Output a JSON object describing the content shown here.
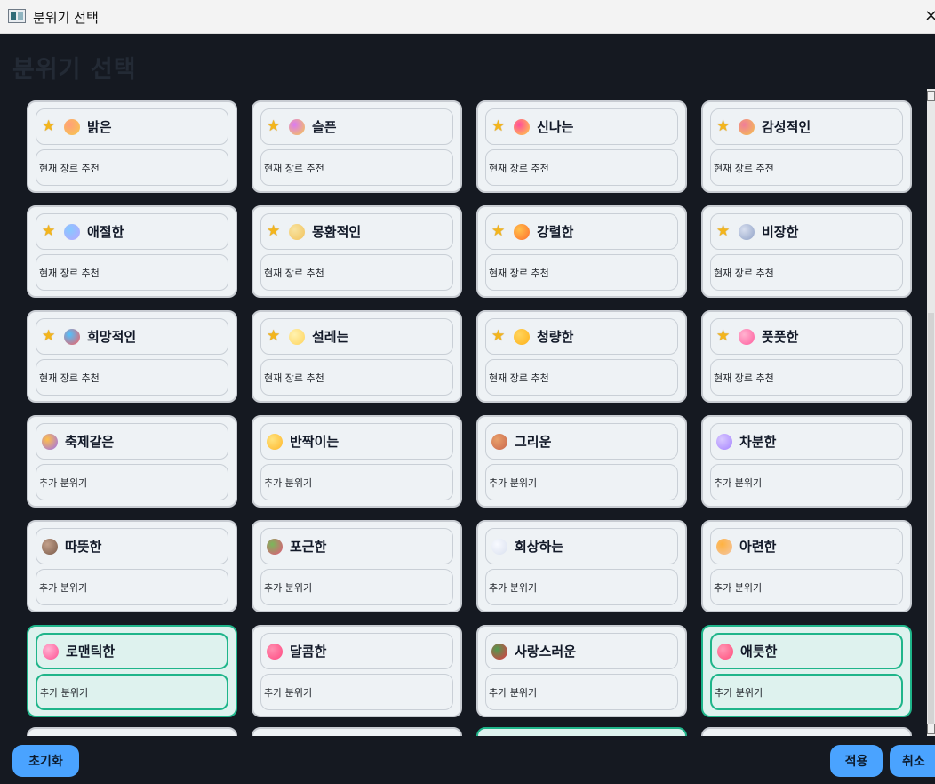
{
  "window": {
    "title": "분위기 선택"
  },
  "page": {
    "heading": "분위기 선택"
  },
  "moods": [
    {
      "name": "밝은",
      "subtitle": "현재 장르 추천",
      "recommended": true,
      "selected": false,
      "emoji_icon": "smiling-face",
      "emoji_colors": [
        "#f6c94c",
        "#ff9f7a"
      ]
    },
    {
      "name": "슬픈",
      "subtitle": "현재 장르 추천",
      "recommended": true,
      "selected": false,
      "emoji_icon": "sad-face",
      "emoji_colors": [
        "#f6c94c",
        "#db7bf2"
      ]
    },
    {
      "name": "신나는",
      "subtitle": "현재 장르 추천",
      "recommended": true,
      "selected": false,
      "emoji_icon": "grinning-face",
      "emoji_colors": [
        "#ffd044",
        "#ff4d9b"
      ]
    },
    {
      "name": "감성적인",
      "subtitle": "현재 장르 추천",
      "recommended": true,
      "selected": false,
      "emoji_icon": "crying-face",
      "emoji_colors": [
        "#f4c24c",
        "#f07d9a"
      ]
    },
    {
      "name": "애절한",
      "subtitle": "현재 장르 추천",
      "recommended": true,
      "selected": false,
      "emoji_icon": "crystal-heart",
      "emoji_colors": [
        "#b9a6ff",
        "#86c9ff"
      ]
    },
    {
      "name": "몽환적인",
      "subtitle": "현재 장르 추천",
      "recommended": true,
      "selected": false,
      "emoji_icon": "crescent-moon",
      "emoji_colors": [
        "#f1c25c",
        "#f8e3a0"
      ]
    },
    {
      "name": "강렬한",
      "subtitle": "현재 장르 추천",
      "recommended": true,
      "selected": false,
      "emoji_icon": "fire",
      "emoji_colors": [
        "#ff6d2d",
        "#ffc04b"
      ]
    },
    {
      "name": "비장한",
      "subtitle": "현재 장르 추천",
      "recommended": true,
      "selected": false,
      "emoji_icon": "crossed-swords",
      "emoji_colors": [
        "#8fa1c6",
        "#d8dfef"
      ]
    },
    {
      "name": "희망적인",
      "subtitle": "현재 장르 추천",
      "recommended": true,
      "selected": false,
      "emoji_icon": "rainbow",
      "emoji_colors": [
        "#ff5b5b",
        "#4ec3ff"
      ]
    },
    {
      "name": "설레는",
      "subtitle": "현재 장르 추천",
      "recommended": true,
      "selected": false,
      "emoji_icon": "sparkles",
      "emoji_colors": [
        "#ffd35a",
        "#fff2b0"
      ]
    },
    {
      "name": "청량한",
      "subtitle": "현재 장르 추천",
      "recommended": true,
      "selected": false,
      "emoji_icon": "sun",
      "emoji_colors": [
        "#ffb21a",
        "#ffd45c"
      ]
    },
    {
      "name": "풋풋한",
      "subtitle": "현재 장르 추천",
      "recommended": true,
      "selected": false,
      "emoji_icon": "cherry-blossom",
      "emoji_colors": [
        "#ff5c9d",
        "#ffb3d0"
      ]
    },
    {
      "name": "축제같은",
      "subtitle": "추가 분위기",
      "recommended": false,
      "selected": false,
      "emoji_icon": "party-popper",
      "emoji_colors": [
        "#9b6df2",
        "#ffc14a"
      ]
    },
    {
      "name": "반짝이는",
      "subtitle": "추가 분위기",
      "recommended": false,
      "selected": false,
      "emoji_icon": "dizzy-star",
      "emoji_colors": [
        "#ffb72c",
        "#ffe37e"
      ]
    },
    {
      "name": "그리운",
      "subtitle": "추가 분위기",
      "recommended": false,
      "selected": false,
      "emoji_icon": "fallen-leaf",
      "emoji_colors": [
        "#c9664d",
        "#e8a06a"
      ]
    },
    {
      "name": "차분한",
      "subtitle": "추가 분위기",
      "recommended": false,
      "selected": false,
      "emoji_icon": "purple-heart",
      "emoji_colors": [
        "#a684ff",
        "#d8c8ff"
      ]
    },
    {
      "name": "따뜻한",
      "subtitle": "추가 분위기",
      "recommended": false,
      "selected": false,
      "emoji_icon": "coffee-cup",
      "emoji_colors": [
        "#7a5a4a",
        "#c2a08a"
      ]
    },
    {
      "name": "포근한",
      "subtitle": "추가 분위기",
      "recommended": false,
      "selected": false,
      "emoji_icon": "tulip",
      "emoji_colors": [
        "#e9547c",
        "#79b85a"
      ]
    },
    {
      "name": "회상하는",
      "subtitle": "추가 분위기",
      "recommended": false,
      "selected": false,
      "emoji_icon": "cloud",
      "emoji_colors": [
        "#d9e0ef",
        "#f8faff"
      ]
    },
    {
      "name": "아련한",
      "subtitle": "추가 분위기",
      "recommended": false,
      "selected": false,
      "emoji_icon": "candle",
      "emoji_colors": [
        "#f2c6a7",
        "#ffb23f"
      ]
    },
    {
      "name": "로맨틱한",
      "subtitle": "추가 분위기",
      "recommended": false,
      "selected": true,
      "emoji_icon": "heart-sparkle",
      "emoji_colors": [
        "#ff4f93",
        "#ffb3d2"
      ]
    },
    {
      "name": "달콤한",
      "subtitle": "추가 분위기",
      "recommended": false,
      "selected": false,
      "emoji_icon": "two-hearts",
      "emoji_colors": [
        "#ff4a82",
        "#ff8fb0"
      ]
    },
    {
      "name": "사랑스러운",
      "subtitle": "추가 분위기",
      "recommended": false,
      "selected": false,
      "emoji_icon": "rose",
      "emoji_colors": [
        "#e63545",
        "#4f9c4f"
      ]
    },
    {
      "name": "애틋한",
      "subtitle": "추가 분위기",
      "recommended": false,
      "selected": true,
      "emoji_icon": "revolving-hearts",
      "emoji_colors": [
        "#ff4d7c",
        "#ff98b5"
      ]
    }
  ],
  "partial_row": [
    {
      "selected": false
    },
    {
      "selected": false
    },
    {
      "selected": true
    },
    {
      "selected": false
    }
  ],
  "buttons": {
    "reset": "초기화",
    "apply": "적용",
    "cancel": "취소"
  },
  "colors": {
    "background": "#151921",
    "card": "#eef2f5",
    "selected_border": "#1fb58a",
    "selected_fill": "#def2ee",
    "button": "#4aa3ff",
    "star": "#f3b51d"
  }
}
